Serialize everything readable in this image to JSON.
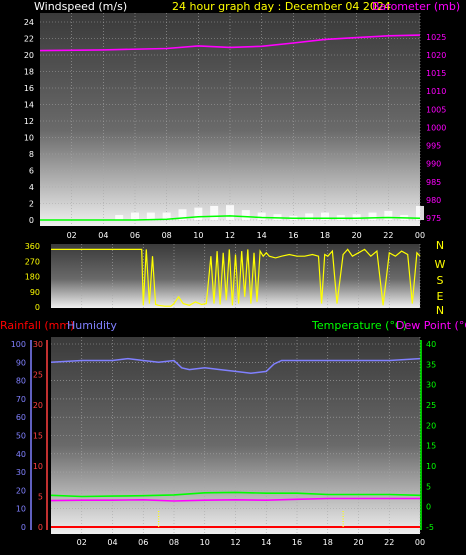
{
  "colors": {
    "background": "#000000",
    "wind_text": "#ffffff",
    "title_text": "#ffff00",
    "barometer": "#ff00ff",
    "direction": "#ffff00",
    "rainfall_text": "#ff0000",
    "rainfall_axis": "#ff4040",
    "humidity": "#8080ff",
    "temperature": "#00ff00",
    "dew_point": "#ff00ff",
    "wind_bars": "#ffffff",
    "wind_avg": "#00ff00",
    "plot_grid": "#a8a8a8",
    "rain_marks": "#ffff00"
  },
  "header": {
    "wind_label": "Windspeed (m/s)",
    "title": "24 hour graph day : December 04 2024",
    "barometer_label": "Barometer (mb)"
  },
  "compass": [
    "N",
    "W",
    "S",
    "E",
    "N"
  ],
  "lower_header": {
    "rainfall_label": "Rainfall (mm)",
    "humidity_label": "Humidity",
    "temperature_label": "Temperature (°C)",
    "dew_label": "Dew Point (°C)"
  },
  "chart_data": [
    {
      "id": "wind_pressure",
      "type": "line",
      "x_ticks": [
        "02",
        "04",
        "06",
        "08",
        "10",
        "12",
        "14",
        "16",
        "18",
        "20",
        "22",
        "00"
      ],
      "left_axis": {
        "label": "Windspeed (m/s)",
        "ticks": [
          "0",
          "2",
          "4",
          "6",
          "8",
          "10",
          "12",
          "14",
          "16",
          "18",
          "20",
          "22",
          "24"
        ],
        "ylim": [
          0,
          24
        ]
      },
      "right_axis": {
        "label": "Barometer (mb)",
        "ticks": [
          "975",
          "980",
          "985",
          "990",
          "995",
          "1000",
          "1005",
          "1010",
          "1015",
          "1020",
          "1025"
        ],
        "ylim": [
          975,
          1028
        ]
      },
      "series": [
        {
          "name": "Barometer (mb)",
          "axis": "right",
          "x": [
            0,
            4,
            8,
            10,
            12,
            14,
            16,
            18,
            20,
            22,
            24
          ],
          "y": [
            1021.2,
            1021.4,
            1021.8,
            1022.5,
            1022.1,
            1022.4,
            1023.3,
            1024.3,
            1024.8,
            1025.3,
            1025.5
          ]
        },
        {
          "name": "Wind gust",
          "axis": "left",
          "style": "bars",
          "x": [
            0,
            1,
            2,
            3,
            4,
            5,
            6,
            7,
            8,
            9,
            10,
            11,
            12,
            13,
            14,
            15,
            16,
            17,
            18,
            19,
            20,
            21,
            22,
            23,
            24
          ],
          "y": [
            0,
            0,
            0,
            0,
            0,
            0.6,
            0.9,
            0.9,
            0.9,
            1.3,
            1.5,
            1.7,
            1.8,
            1.2,
            0.9,
            0.7,
            0.5,
            0.8,
            0.9,
            0.6,
            0.7,
            0.9,
            1.1,
            0.6,
            1.7
          ]
        },
        {
          "name": "Wind average",
          "axis": "left",
          "x": [
            0,
            6,
            8,
            10,
            12,
            14,
            16,
            18,
            20,
            22,
            24
          ],
          "y": [
            0,
            0,
            0.1,
            0.4,
            0.5,
            0.3,
            0.2,
            0.2,
            0.2,
            0.3,
            0.2
          ]
        }
      ]
    },
    {
      "id": "direction",
      "type": "line",
      "x_ticks": [
        "02",
        "04",
        "06",
        "08",
        "10",
        "12",
        "14",
        "16",
        "18",
        "20",
        "22",
        "00"
      ],
      "left_axis": {
        "ticks": [
          "0",
          "90",
          "180",
          "270",
          "360"
        ],
        "ylim": [
          0,
          360
        ]
      },
      "series": [
        {
          "name": "Wind direction",
          "x": [
            0,
            5.9,
            6.0,
            6.2,
            6.4,
            6.6,
            6.8,
            7.0,
            7.4,
            7.8,
            8.0,
            8.3,
            8.6,
            9.0,
            9.4,
            9.8,
            10.1,
            10.4,
            10.6,
            10.8,
            11.0,
            11.2,
            11.4,
            11.6,
            11.8,
            12.0,
            12.2,
            12.4,
            12.6,
            12.8,
            13.0,
            13.2,
            13.4,
            13.6,
            13.8,
            14.0,
            14.2,
            14.6,
            15.0,
            15.5,
            16.0,
            16.5,
            17.0,
            17.4,
            17.6,
            17.8,
            18.0,
            18.3,
            18.6,
            19.0,
            19.3,
            19.6,
            20.0,
            20.4,
            20.8,
            21.2,
            21.6,
            22.0,
            22.4,
            22.8,
            23.2,
            23.5,
            23.8,
            24
          ],
          "y": [
            340,
            340,
            10,
            340,
            20,
            300,
            15,
            10,
            5,
            5,
            20,
            60,
            20,
            10,
            30,
            15,
            20,
            300,
            20,
            330,
            15,
            320,
            40,
            340,
            10,
            310,
            20,
            330,
            60,
            340,
            20,
            320,
            30,
            330,
            300,
            320,
            300,
            290,
            300,
            310,
            300,
            300,
            310,
            300,
            20,
            310,
            300,
            330,
            20,
            310,
            340,
            300,
            320,
            340,
            300,
            330,
            10,
            320,
            300,
            330,
            310,
            20,
            320,
            300
          ]
        }
      ]
    },
    {
      "id": "rain_humidity_temperature",
      "type": "line",
      "x_ticks": [
        "02",
        "04",
        "06",
        "08",
        "10",
        "12",
        "14",
        "16",
        "18",
        "20",
        "22",
        "00"
      ],
      "humidity_axis": {
        "label": "Humidity",
        "ticks": [
          "0",
          "10",
          "20",
          "30",
          "40",
          "50",
          "60",
          "70",
          "80",
          "90",
          "100"
        ],
        "ylim": [
          0,
          100
        ]
      },
      "rain_axis": {
        "label": "Rainfall (mm)",
        "ticks": [
          "0",
          "5",
          "10",
          "15",
          "20",
          "25",
          "30"
        ],
        "ylim": [
          0,
          30
        ]
      },
      "temp_axis": {
        "label": "Temperature (°C)",
        "ticks": [
          "-5",
          "0",
          "5",
          "10",
          "15",
          "20",
          "25",
          "30",
          "35",
          "40"
        ],
        "ylim": [
          -5,
          40
        ]
      },
      "series": [
        {
          "name": "Humidity",
          "axis": "humidity",
          "x": [
            0,
            2,
            4,
            5,
            6,
            7,
            8,
            8.5,
            9,
            10,
            11,
            12,
            13,
            14,
            14.5,
            15,
            16,
            18,
            20,
            22,
            24
          ],
          "y": [
            90,
            91,
            91,
            92,
            91,
            90,
            91,
            87,
            86,
            87,
            86,
            85,
            84,
            85,
            89,
            91,
            91,
            91,
            91,
            91,
            92
          ]
        },
        {
          "name": "Temperature (°C)",
          "axis": "temperature",
          "x": [
            0,
            2,
            4,
            6,
            8,
            10,
            12,
            14,
            16,
            18,
            20,
            22,
            24
          ],
          "y": [
            2.8,
            2.5,
            2.6,
            2.7,
            2.9,
            3.4,
            3.5,
            3.3,
            3.3,
            3.0,
            3.0,
            3.0,
            2.8
          ]
        },
        {
          "name": "Dew Point (°C)",
          "axis": "temperature",
          "x": [
            0,
            2,
            4,
            6,
            8,
            10,
            12,
            14,
            16,
            18,
            20,
            22,
            24
          ],
          "y": [
            1.5,
            1.6,
            1.6,
            1.7,
            1.4,
            1.6,
            1.7,
            1.6,
            1.8,
            2.0,
            2.0,
            2.0,
            2.0
          ]
        },
        {
          "name": "Rainfall (mm)",
          "axis": "rain",
          "x": [
            0,
            24
          ],
          "y": [
            0,
            0
          ]
        },
        {
          "name": "Rain rate",
          "axis": "rain",
          "style": "marks",
          "x": [
            7,
            19
          ],
          "y": [
            2.8,
            2.8
          ]
        }
      ]
    }
  ]
}
